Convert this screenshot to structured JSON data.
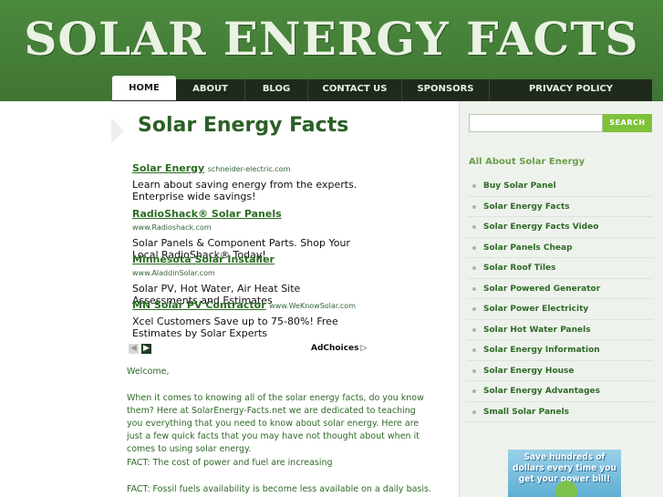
{
  "site": {
    "logo_text": "SOLAR ENERGY FACTS"
  },
  "nav": [
    {
      "label": "HOME",
      "active": true
    },
    {
      "label": "ABOUT"
    },
    {
      "label": "BLOG"
    },
    {
      "label": "CONTACT US"
    },
    {
      "label": "SPONSORS"
    },
    {
      "label": "PRIVACY POLICY"
    }
  ],
  "main": {
    "title": "Solar Energy Facts",
    "ads": [
      {
        "title": "Solar Energy",
        "domain": "schneider-electric.com",
        "body": "Learn about saving energy from the experts. Enterprise wide savings!"
      },
      {
        "title": "RadioShack® Solar Panels",
        "domain": "www.Radioshack.com",
        "body": "Solar Panels & Component Parts. Shop Your Local RadioShack® Today!"
      },
      {
        "title": "Minnesota Solar Installer",
        "domain": "www.AladdinSolar.com",
        "body": "Solar PV, Hot Water, Air Heat Site Assessments and Estimates"
      },
      {
        "title": "MN Solar PV Contractor",
        "domain": "www.WeKnowSolar.com",
        "body": "Xcel Customers Save up to 75-80%! Free Estimates by Solar Experts"
      }
    ],
    "adchoices": "AdChoices",
    "paragraphs": [
      "Welcome,",
      "When it comes to knowing all of the solar energy facts, do you know them? Here at SolarEnergy-Facts.net we are dedicated to teaching you everything that you need to know about solar energy. Here are just a few quick facts that you may have not thought about when it comes to using solar energy.",
      "FACT: The cost of power and fuel are increasing",
      "FACT: Fossil fuels availability is become less available on a daily basis."
    ]
  },
  "sidebar": {
    "search_button": "SEARCH",
    "search_value": "",
    "heading": "All About Solar Energy",
    "links": [
      "Buy Solar Panel",
      "Solar Energy Facts",
      "Solar Energy Facts Video",
      "Solar Panels Cheap",
      "Solar Roof Tiles",
      "Solar Powered Generator",
      "Solar Power Electricity",
      "Solar Hot Water Panels",
      "Solar Energy Information",
      "Solar Energy House",
      "Solar Energy Advantages",
      "Small Solar Panels"
    ],
    "promo_text": "Save hundreds of dollars every time you get your power bill!"
  }
}
